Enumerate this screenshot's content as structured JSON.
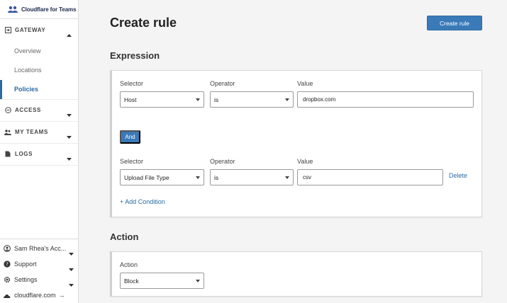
{
  "brand": {
    "name": "Cloudflare for Teams"
  },
  "sidebar": {
    "gateway": {
      "label": "GATEWAY",
      "items": [
        {
          "label": "Overview",
          "active": false
        },
        {
          "label": "Locations",
          "active": false
        },
        {
          "label": "Policies",
          "active": true
        }
      ]
    },
    "sections": [
      {
        "label": "ACCESS",
        "icon": "access-icon"
      },
      {
        "label": "MY TEAMS",
        "icon": "people-icon"
      },
      {
        "label": "LOGS",
        "icon": "document-icon"
      }
    ],
    "bottom": {
      "account": "Sam Rhea's Acc...",
      "support": "Support",
      "settings": "Settings",
      "link": "cloudflare.com"
    }
  },
  "header": {
    "title": "Create rule",
    "create_button": "Create rule"
  },
  "expression": {
    "heading": "Expression",
    "conditions": [
      {
        "selector_label": "Selector",
        "selector": "Host",
        "operator_label": "Operator",
        "operator": "is",
        "value_label": "Value",
        "value": "dropbox.com"
      },
      {
        "selector_label": "Selector",
        "selector": "Upload File Type",
        "operator_label": "Operator",
        "operator": "is",
        "value_label": "Value",
        "value": "csv",
        "delete_label": "Delete"
      }
    ],
    "and_button": "And",
    "add_condition": "+ Add Condition"
  },
  "action": {
    "heading": "Action",
    "label": "Action",
    "value": "Block"
  },
  "colors": {
    "accent": "#3a7ab8",
    "link": "#2b6aa3"
  }
}
